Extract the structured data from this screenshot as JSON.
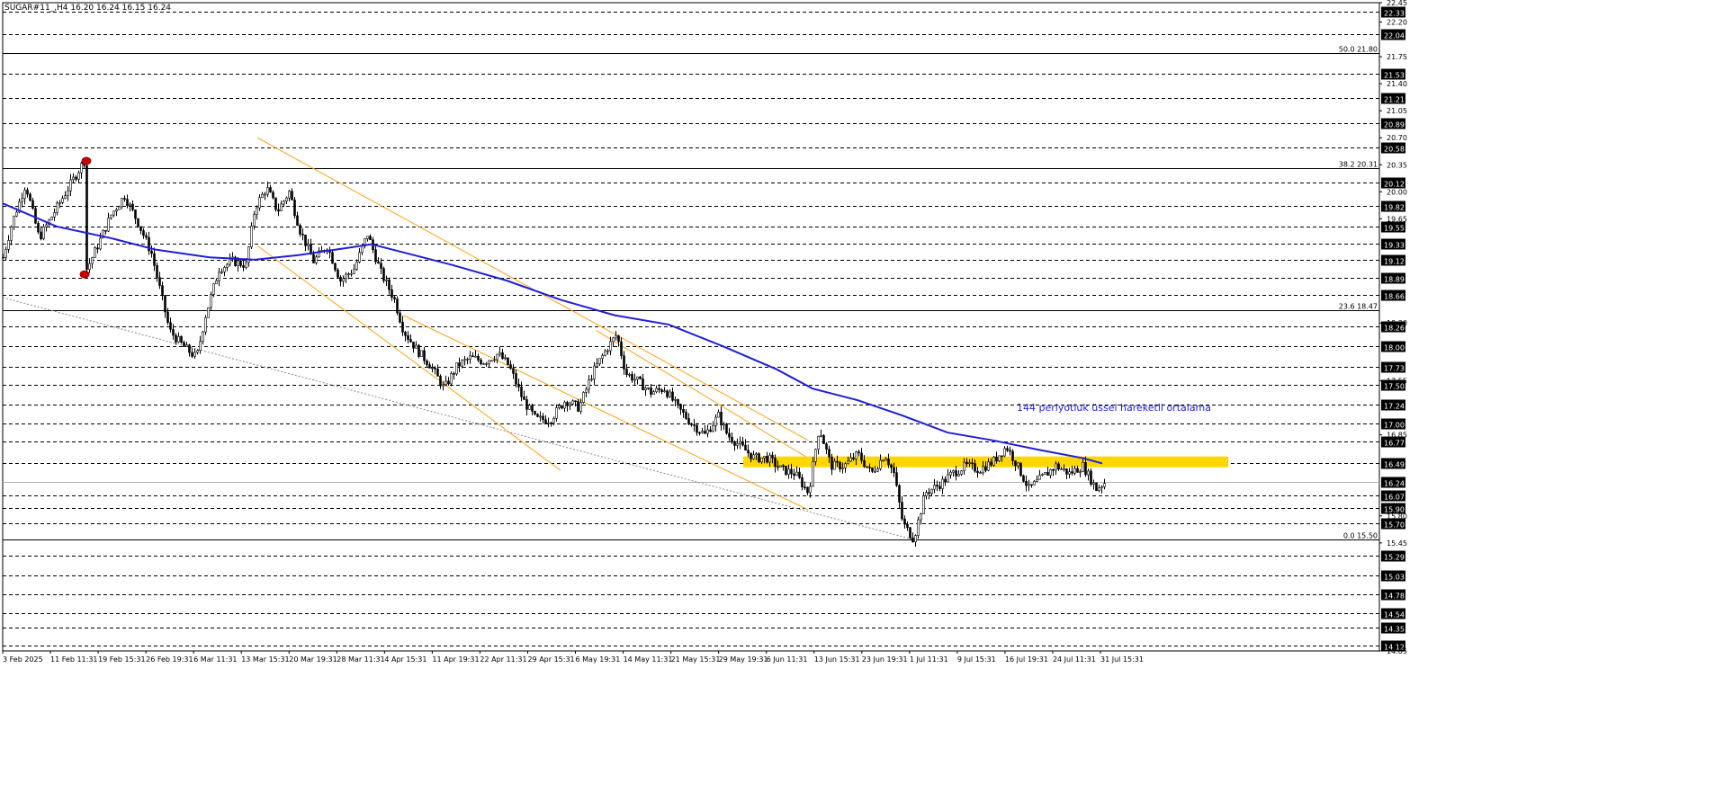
{
  "header": {
    "symbol_text": "SUGAR#11_,H4  16.20 16.24 16.15 16.24"
  },
  "annotation": {
    "ema_label": "144 periyotluk üssel hareketli ortalama"
  },
  "colors": {
    "background": "#ffffff",
    "candle": "#000000",
    "ema": "#1f1fd6",
    "channel": "#ffa019",
    "zone": "#ffd700",
    "fib": "#000000",
    "marker": "#cc0000"
  },
  "chart_data": {
    "type": "candlestick",
    "symbol": "SUGAR#11_",
    "timeframe": "H4",
    "ohlc_header": {
      "open": 16.2,
      "high": 16.24,
      "low": 16.15,
      "close": 16.24
    },
    "ylim": [
      14.05,
      22.45
    ],
    "y_tick_labels": [
      "22.45",
      "22.20",
      "21.75",
      "21.40",
      "21.05",
      "20.70",
      "20.35",
      "20.00",
      "19.65",
      "18.30",
      "17.55",
      "16.85",
      "15.80",
      "15.45",
      "14.05"
    ],
    "h_levels": [
      "22.33",
      "22.04",
      "21.53",
      "21.21",
      "20.89",
      "20.58",
      "20.12",
      "19.82",
      "19.55",
      "19.33",
      "19.12",
      "18.89",
      "18.66",
      "18.26",
      "18.00",
      "17.73",
      "17.50",
      "17.24",
      "17.00",
      "16.77",
      "16.49",
      "16.07",
      "15.90",
      "15.70",
      "15.29",
      "15.03",
      "14.78",
      "14.54",
      "14.35",
      "14.12"
    ],
    "fib_levels": [
      {
        "label": "50.0 21.80",
        "price": 21.8
      },
      {
        "label": "38.2 20.31",
        "price": 20.31
      },
      {
        "label": "23.6 18.47",
        "price": 18.47
      },
      {
        "label": "0.0 15.50",
        "price": 15.5
      }
    ],
    "current_price": "16.24",
    "x_tick_labels": [
      "3 Feb 2025",
      "11 Feb 11:31",
      "19 Feb 15:31",
      "26 Feb 19:31",
      "6 Mar 11:31",
      "13 Mar 15:31",
      "20 Mar 19:31",
      "28 Mar 11:31",
      "4 Apr 15:31",
      "11 Apr 19:31",
      "22 Apr 11:31",
      "29 Apr 15:31",
      "6 May 19:31",
      "14 May 11:31",
      "21 May 15:31",
      "29 May 19:31",
      "6 Jun 11:31",
      "13 Jun 15:31",
      "23 Jun 19:31",
      "1 Jul 11:31",
      "9 Jul 15:31",
      "16 Jul 19:31",
      "24 Jul 11:31",
      "31 Jul 15:31"
    ],
    "price_path": [
      [
        0,
        19.15
      ],
      [
        10,
        19.6
      ],
      [
        25,
        20.1
      ],
      [
        40,
        19.4
      ],
      [
        55,
        19.7
      ],
      [
        75,
        20.1
      ],
      [
        90,
        20.4
      ],
      [
        93,
        19.0
      ],
      [
        105,
        19.3
      ],
      [
        120,
        19.7
      ],
      [
        135,
        19.95
      ],
      [
        150,
        19.6
      ],
      [
        165,
        19.2
      ],
      [
        175,
        18.7
      ],
      [
        185,
        18.2
      ],
      [
        200,
        18.0
      ],
      [
        215,
        17.85
      ],
      [
        225,
        18.4
      ],
      [
        240,
        19.0
      ],
      [
        255,
        19.1
      ],
      [
        270,
        19.05
      ],
      [
        280,
        19.8
      ],
      [
        293,
        20.05
      ],
      [
        305,
        19.75
      ],
      [
        318,
        20.0
      ],
      [
        330,
        19.5
      ],
      [
        345,
        19.1
      ],
      [
        360,
        19.3
      ],
      [
        375,
        18.85
      ],
      [
        390,
        19.0
      ],
      [
        405,
        19.45
      ],
      [
        420,
        18.95
      ],
      [
        435,
        18.6
      ],
      [
        445,
        18.2
      ],
      [
        460,
        17.95
      ],
      [
        475,
        17.75
      ],
      [
        490,
        17.45
      ],
      [
        505,
        17.75
      ],
      [
        520,
        17.85
      ],
      [
        535,
        17.8
      ],
      [
        550,
        17.9
      ],
      [
        562,
        17.75
      ],
      [
        578,
        17.3
      ],
      [
        592,
        17.05
      ],
      [
        608,
        17.05
      ],
      [
        625,
        17.3
      ],
      [
        640,
        17.2
      ],
      [
        655,
        17.65
      ],
      [
        670,
        17.95
      ],
      [
        682,
        18.15
      ],
      [
        692,
        17.65
      ],
      [
        705,
        17.55
      ],
      [
        720,
        17.4
      ],
      [
        735,
        17.45
      ],
      [
        750,
        17.2
      ],
      [
        765,
        17.0
      ],
      [
        780,
        16.85
      ],
      [
        795,
        17.1
      ],
      [
        805,
        16.85
      ],
      [
        820,
        16.7
      ],
      [
        835,
        16.55
      ],
      [
        850,
        16.55
      ],
      [
        865,
        16.4
      ],
      [
        880,
        16.35
      ],
      [
        895,
        16.1
      ],
      [
        907,
        16.95
      ],
      [
        920,
        16.45
      ],
      [
        935,
        16.45
      ],
      [
        950,
        16.6
      ],
      [
        965,
        16.35
      ],
      [
        980,
        16.6
      ],
      [
        990,
        16.35
      ],
      [
        1000,
        15.7
      ],
      [
        1012,
        15.5
      ],
      [
        1025,
        16.1
      ],
      [
        1040,
        16.2
      ],
      [
        1055,
        16.35
      ],
      [
        1070,
        16.45
      ],
      [
        1085,
        16.4
      ],
      [
        1100,
        16.5
      ],
      [
        1115,
        16.7
      ],
      [
        1125,
        16.5
      ],
      [
        1140,
        16.15
      ],
      [
        1155,
        16.3
      ],
      [
        1170,
        16.45
      ],
      [
        1185,
        16.35
      ],
      [
        1200,
        16.45
      ],
      [
        1215,
        16.15
      ],
      [
        1225,
        16.24
      ]
    ],
    "ema_144": [
      [
        0,
        19.85
      ],
      [
        60,
        19.55
      ],
      [
        120,
        19.4
      ],
      [
        170,
        19.25
      ],
      [
        230,
        19.15
      ],
      [
        280,
        19.12
      ],
      [
        330,
        19.18
      ],
      [
        370,
        19.25
      ],
      [
        410,
        19.32
      ],
      [
        450,
        19.2
      ],
      [
        500,
        19.05
      ],
      [
        560,
        18.85
      ],
      [
        620,
        18.6
      ],
      [
        680,
        18.4
      ],
      [
        740,
        18.28
      ],
      [
        800,
        18.0
      ],
      [
        860,
        17.7
      ],
      [
        900,
        17.45
      ],
      [
        950,
        17.3
      ],
      [
        1000,
        17.1
      ],
      [
        1050,
        16.88
      ],
      [
        1100,
        16.78
      ],
      [
        1150,
        16.66
      ],
      [
        1200,
        16.55
      ],
      [
        1222,
        16.48
      ]
    ],
    "channel_lines": [
      {
        "from": [
          283,
          20.7
        ],
        "to": [
          895,
          16.78
        ]
      },
      {
        "from": [
          283,
          19.3
        ],
        "to": [
          620,
          16.39
        ]
      },
      {
        "from": [
          445,
          18.4
        ],
        "to": [
          895,
          15.88
        ]
      },
      {
        "from": [
          660,
          18.2
        ],
        "to": [
          895,
          16.55
        ]
      }
    ],
    "support_dotted": {
      "from": [
        0,
        18.63
      ],
      "to": [
        1010,
        15.5
      ]
    },
    "zone": {
      "x_from": 823,
      "x_to": 1362,
      "price_low": 16.43,
      "price_high": 16.57
    },
    "markers": [
      {
        "x": 93,
        "price": 20.4
      },
      {
        "x": 91,
        "price": 18.93
      }
    ]
  }
}
